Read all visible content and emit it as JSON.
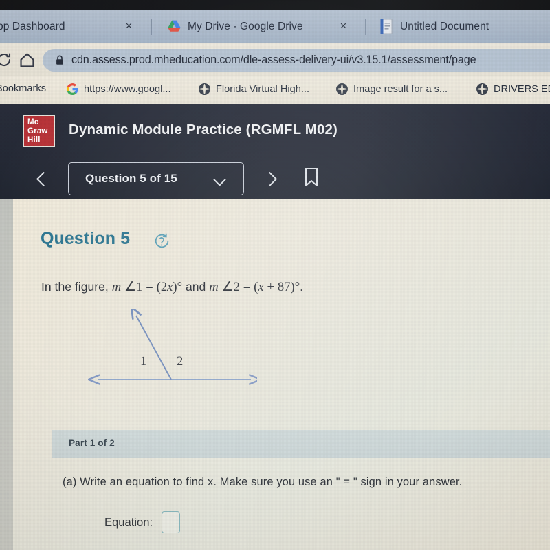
{
  "browser": {
    "tabs": [
      {
        "title": "pp Dashboard",
        "icon": "none",
        "close_label": "×"
      },
      {
        "title": "My Drive - Google Drive",
        "icon": "google-drive-icon",
        "close_label": "×"
      },
      {
        "title": "Untitled Document",
        "icon": "google-docs-icon",
        "close_label": ""
      }
    ],
    "toolbar": {
      "reload_icon": "reload-icon",
      "home_icon": "home-icon",
      "lock_icon": "lock-icon",
      "url": "cdn.assess.prod.mheducation.com/dle-assess-delivery-ui/v3.15.1/assessment/page"
    },
    "bookmarks_label": "Bookmarks",
    "bookmarks": [
      {
        "label": "https://www.googl...",
        "icon": "google-icon"
      },
      {
        "label": "Florida Virtual High...",
        "icon": "globe-icon"
      },
      {
        "label": "Image result for a s...",
        "icon": "globe-icon"
      },
      {
        "label": "DRIVERS ED",
        "icon": "globe-icon"
      }
    ]
  },
  "app": {
    "logo_line1": "Mc",
    "logo_line2": "Graw",
    "logo_line3": "Hill",
    "title": "Dynamic Module Practice (RGMFL M02)",
    "nav": {
      "prev_icon": "chevron-left-icon",
      "next_icon": "chevron-right-icon",
      "question_selector": "Question 5 of 15",
      "caret_icon": "chevron-down-icon",
      "bookmark_icon": "bookmark-icon"
    },
    "colors": {
      "header_bg": "#181d2b",
      "logo_red": "#b4262c",
      "question_heading": "#1f6e8c",
      "part_band": "#c9d4d6",
      "input_border": "#7fb3bb",
      "figure_stroke": "#7e95c4"
    }
  },
  "question": {
    "heading": "Question 5",
    "regenerate_icon": "regenerate-question-icon",
    "stem": {
      "prefix": "In the figure, ",
      "m1": "m",
      "angle_sym": "∠",
      "one": "1",
      "eq1": "=",
      "open1": "(",
      "coef": "2",
      "x1": "x",
      "close1": ")",
      "deg1": "°",
      "conj": " and ",
      "m2": "m",
      "two": "2",
      "eq2": "=",
      "open2": "(",
      "x2": "x",
      "plus": "+",
      "const": "87",
      "close2": ")",
      "deg2": "°",
      "period": "."
    },
    "figure": {
      "label_1": "1",
      "label_2": "2",
      "description": "horizontal double-headed arrow with a ray from the vertex going up and to the left"
    },
    "part_label": "Part 1 of 2",
    "part_a_text": "(a) Write an equation to find x. Make sure you use an \" = \" sign in your answer.",
    "equation_label": "Equation:",
    "equation_value": ""
  }
}
